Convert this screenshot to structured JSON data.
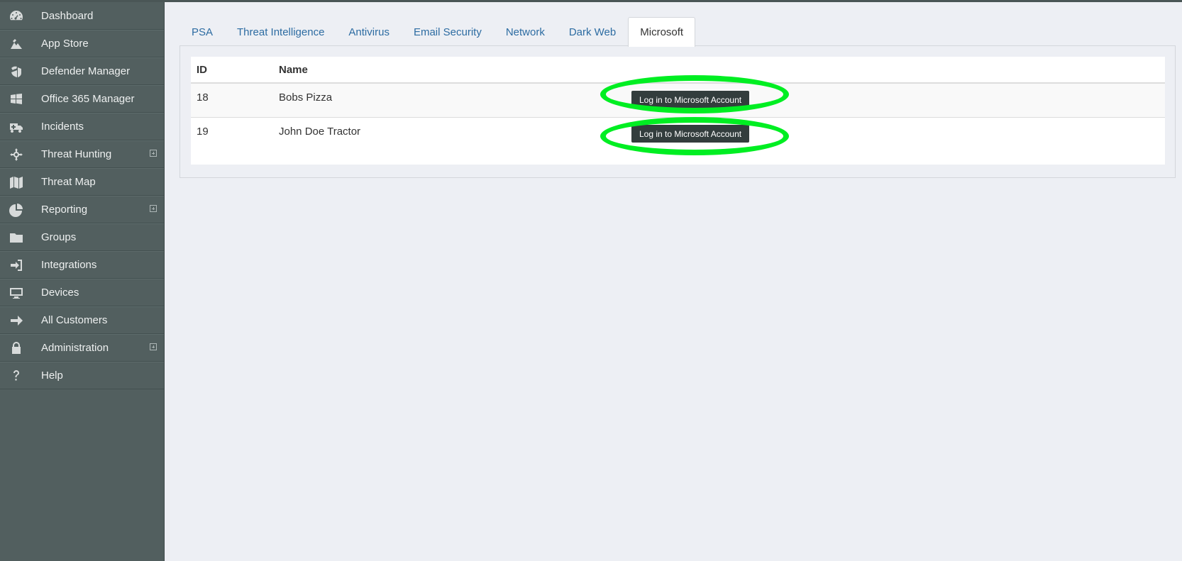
{
  "sidebar": {
    "items": [
      {
        "label": "Dashboard",
        "icon": "dashboard-icon",
        "expandable": false
      },
      {
        "label": "App Store",
        "icon": "app-store-icon",
        "expandable": false
      },
      {
        "label": "Defender Manager",
        "icon": "defender-icon",
        "expandable": false
      },
      {
        "label": "Office 365 Manager",
        "icon": "windows-icon",
        "expandable": false
      },
      {
        "label": "Incidents",
        "icon": "ambulance-icon",
        "expandable": false
      },
      {
        "label": "Threat Hunting",
        "icon": "crosshair-icon",
        "expandable": true
      },
      {
        "label": "Threat Map",
        "icon": "map-icon",
        "expandable": false
      },
      {
        "label": "Reporting",
        "icon": "pie-chart-icon",
        "expandable": true
      },
      {
        "label": "Groups",
        "icon": "folder-icon",
        "expandable": false
      },
      {
        "label": "Integrations",
        "icon": "sign-in-icon",
        "expandable": false
      },
      {
        "label": "Devices",
        "icon": "monitor-icon",
        "expandable": false
      },
      {
        "label": "All Customers",
        "icon": "arrow-right-icon",
        "expandable": false
      },
      {
        "label": "Administration",
        "icon": "lock-icon",
        "expandable": true
      },
      {
        "label": "Help",
        "icon": "question-icon",
        "expandable": false
      }
    ]
  },
  "tabs": [
    {
      "label": "PSA",
      "active": false
    },
    {
      "label": "Threat Intelligence",
      "active": false
    },
    {
      "label": "Antivirus",
      "active": false
    },
    {
      "label": "Email Security",
      "active": false
    },
    {
      "label": "Network",
      "active": false
    },
    {
      "label": "Dark Web",
      "active": false
    },
    {
      "label": "Microsoft",
      "active": true
    }
  ],
  "table": {
    "headers": {
      "id": "ID",
      "name": "Name"
    },
    "rows": [
      {
        "id": "18",
        "name": "Bobs Pizza",
        "action": "Log in to Microsoft Account"
      },
      {
        "id": "19",
        "name": "John Doe Tractor",
        "action": "Log in to Microsoft Account"
      }
    ]
  },
  "colors": {
    "sidebar_bg": "#525f5f",
    "link": "#2d6ca2",
    "button_bg": "#333d3d",
    "highlight": "#00ee22"
  }
}
